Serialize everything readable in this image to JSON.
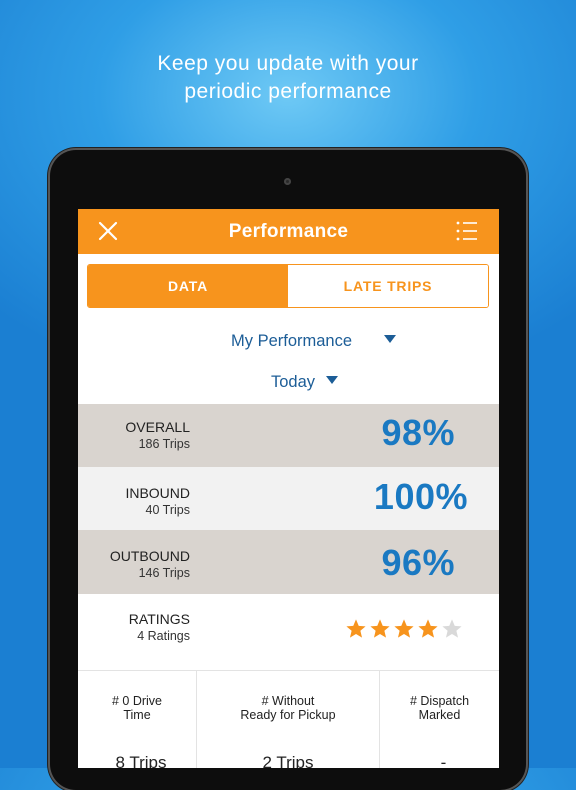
{
  "headline": {
    "line1": "Keep you update with your",
    "line2": "periodic performance"
  },
  "navbar": {
    "title": "Performance",
    "close_icon": "close-icon",
    "menu_icon": "list-menu-icon",
    "color": "#f7941d"
  },
  "tabs": [
    {
      "label": "DATA",
      "active": true
    },
    {
      "label": "LATE TRIPS",
      "active": false
    }
  ],
  "filters": {
    "scope": "My Performance",
    "period": "Today"
  },
  "metrics": [
    {
      "label": "OVERALL",
      "sub": "186 Trips",
      "value": "98%"
    },
    {
      "label": "INBOUND",
      "sub": "40 Trips",
      "value": "100%"
    },
    {
      "label": "OUTBOUND",
      "sub": "146 Trips",
      "value": "96%"
    }
  ],
  "ratings": {
    "label": "RATINGS",
    "sub": "4 Ratings",
    "stars_filled": 4,
    "stars_total": 5,
    "star_color": "#f7941d",
    "star_empty_color": "#d9d9d9"
  },
  "bottom_columns": [
    {
      "line1": "# 0 Drive",
      "line2": "Time",
      "value": "8 Trips"
    },
    {
      "line1": "# Without",
      "line2": "Ready for Pickup",
      "value": "2 Trips"
    },
    {
      "line1": "# Dispatch",
      "line2": "Marked",
      "value": "-"
    }
  ],
  "colors": {
    "accent": "#f7941d",
    "value_blue": "#1a79c2",
    "link_blue": "#1c5d97",
    "row_shaded": "#d9d4cf",
    "row_light": "#f2f2f2"
  }
}
